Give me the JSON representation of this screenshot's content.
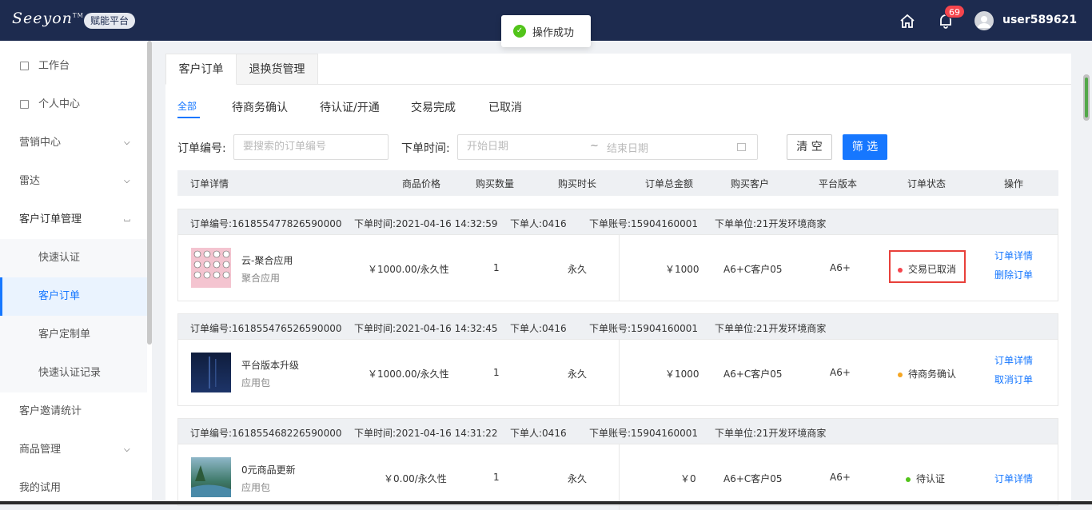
{
  "header": {
    "logo": "Seeyon",
    "logo_tm": "TM",
    "platform": "赋能平台",
    "notification_count": "69",
    "username": "user589621"
  },
  "toast": {
    "message": "操作成功"
  },
  "sidebar": {
    "items": [
      {
        "label": "工作台"
      },
      {
        "label": "个人中心"
      },
      {
        "label": "营销中心"
      },
      {
        "label": "雷达"
      },
      {
        "label": "客户订单管理"
      },
      {
        "label": "快速认证"
      },
      {
        "label": "客户订单"
      },
      {
        "label": "客户定制单"
      },
      {
        "label": "快速认证记录"
      },
      {
        "label": "客户邀请统计"
      },
      {
        "label": "商品管理"
      },
      {
        "label": "我的试用"
      }
    ]
  },
  "tabs": [
    "客户订单",
    "退换货管理"
  ],
  "status_tabs": [
    "全部",
    "待商务确认",
    "待认证/开通",
    "交易完成",
    "已取消"
  ],
  "filters": {
    "order_no_label": "订单编号:",
    "order_no_placeholder": "要搜索的订单编号",
    "time_label": "下单时间:",
    "start_placeholder": "开始日期",
    "tilde": "~",
    "end_placeholder": "结束日期",
    "clear": "清 空",
    "filter": "筛 选"
  },
  "columns": [
    "订单详情",
    "商品价格",
    "购买数量",
    "购买时长",
    "订单总金额",
    "购买客户",
    "平台版本",
    "订单状态",
    "操作"
  ],
  "orders": [
    {
      "order_no": "订单编号:161855477826590000",
      "time": "下单时间:2021-04-16 14:32:59",
      "person": "下单人:0416",
      "account": "下单账号:15904160001",
      "unit": "下单单位:21开发环境商家",
      "name": "云-聚合应用",
      "type": "聚合应用",
      "price": "￥1000.00/永久性",
      "qty": "1",
      "duration": "永久",
      "total": "￥1000",
      "customer": "A6+C客户05",
      "version": "A6+",
      "status": "交易已取消",
      "status_color": "#f5454d",
      "actions": [
        "订单详情",
        "删除订单"
      ]
    },
    {
      "order_no": "订单编号:161855476526590000",
      "time": "下单时间:2021-04-16 14:32:45",
      "person": "下单人:0416",
      "account": "下单账号:15904160001",
      "unit": "下单单位:21开发环境商家",
      "name": "平台版本升级",
      "type": "应用包",
      "price": "￥1000.00/永久性",
      "qty": "1",
      "duration": "永久",
      "total": "￥1000",
      "customer": "A6+C客户05",
      "version": "A6+",
      "status": "待商务确认",
      "status_color": "#f5a623",
      "actions": [
        "订单详情",
        "取消订单"
      ]
    },
    {
      "order_no": "订单编号:161855468226590000",
      "time": "下单时间:2021-04-16 14:31:22",
      "person": "下单人:0416",
      "account": "下单账号:15904160001",
      "unit": "下单单位:21开发环境商家",
      "name": "0元商品更新",
      "type": "应用包",
      "price": "￥0.00/永久性",
      "qty": "1",
      "duration": "永久",
      "total": "￥0",
      "customer": "A6+C客户05",
      "version": "A6+",
      "status": "待认证",
      "status_color": "#52c41a",
      "actions": [
        "订单详情"
      ]
    }
  ]
}
